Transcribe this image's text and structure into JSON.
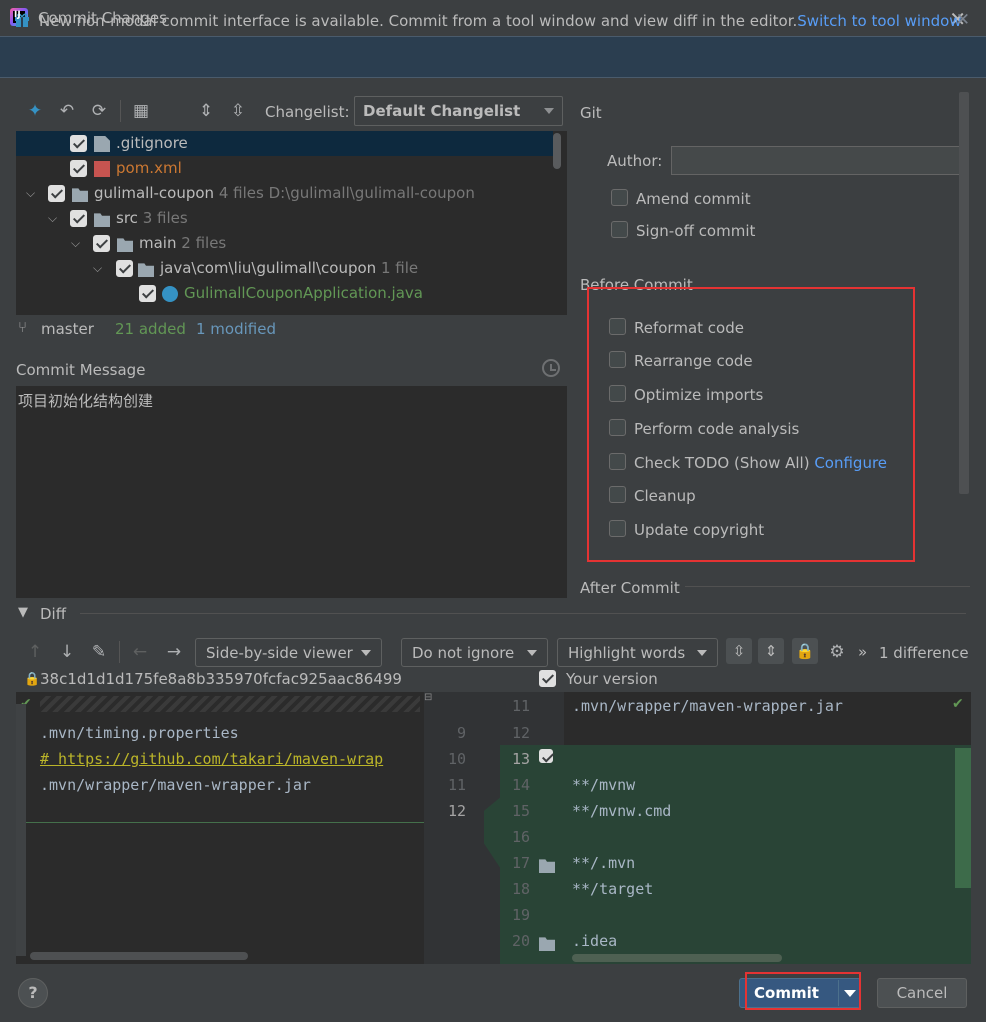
{
  "window": {
    "title": "Commit Changes"
  },
  "banner": {
    "text": "New non-modal commit interface is available. Commit from a tool window and view diff in the editor.",
    "link": "Switch to tool window"
  },
  "toolbar": {
    "changelist_label": "Changelist:",
    "changelist_value": "Default Changelist"
  },
  "tree": {
    "rows": [
      {
        "label": ".gitignore",
        "extra": "",
        "color": "#6897bb"
      },
      {
        "label": "pom.xml",
        "extra": "",
        "color": "#cc7832"
      },
      {
        "label": "gulimall-coupon",
        "extra": "4 files  D:\\gulimall\\gulimall-coupon",
        "color": "#bbbbbb"
      },
      {
        "label": "src",
        "extra": "3 files",
        "color": "#bbbbbb"
      },
      {
        "label": "main",
        "extra": "2 files",
        "color": "#bbbbbb"
      },
      {
        "label": "java\\com\\liu\\gulimall\\coupon",
        "extra": "1 file",
        "color": "#bbbbbb"
      },
      {
        "label": "GulimallCouponApplication.java",
        "extra": "",
        "color": "#629755"
      }
    ]
  },
  "status": {
    "branch": "master",
    "added": "21 added",
    "modified": "1 modified"
  },
  "commit_message": {
    "label": "Commit Message",
    "value": "项目初始化结构创建"
  },
  "git": {
    "section": "Git",
    "author_label": "Author:",
    "author_value": "",
    "amend": "Amend commit",
    "signoff": "Sign-off commit"
  },
  "before_commit": {
    "label": "Before Commit",
    "options": [
      "Reformat code",
      "Rearrange code",
      "Optimize imports",
      "Perform code analysis",
      "Check TODO (Show All)",
      "Cleanup",
      "Update copyright"
    ],
    "configure": "Configure"
  },
  "after_commit": {
    "label": "After Commit"
  },
  "diff": {
    "label": "Diff",
    "viewer": "Side-by-side viewer",
    "ignore": "Do not ignore",
    "highlight": "Highlight words",
    "count": "1 difference",
    "hash": "38c1d1d1d175fe8a8b335970fcfac925aac86499",
    "your_version": "Your version",
    "left_lines": [
      ".mvn/timing.properties",
      "# https://github.com/takari/maven-wrap",
      ".mvn/wrapper/maven-wrapper.jar"
    ],
    "gutter_left": [
      "9",
      "10",
      "11",
      "12"
    ],
    "gutter_right": [
      "11",
      "12",
      "13",
      "14",
      "15",
      "16",
      "17",
      "18",
      "19",
      "20"
    ],
    "right_lines": [
      ".mvn/wrapper/maven-wrapper.jar",
      "",
      "",
      "**/mvnw",
      "**/mvnw.cmd",
      "",
      "**/.mvn",
      "**/target",
      "",
      ".idea"
    ]
  },
  "buttons": {
    "help": "?",
    "commit": "Commit",
    "cancel": "Cancel"
  }
}
